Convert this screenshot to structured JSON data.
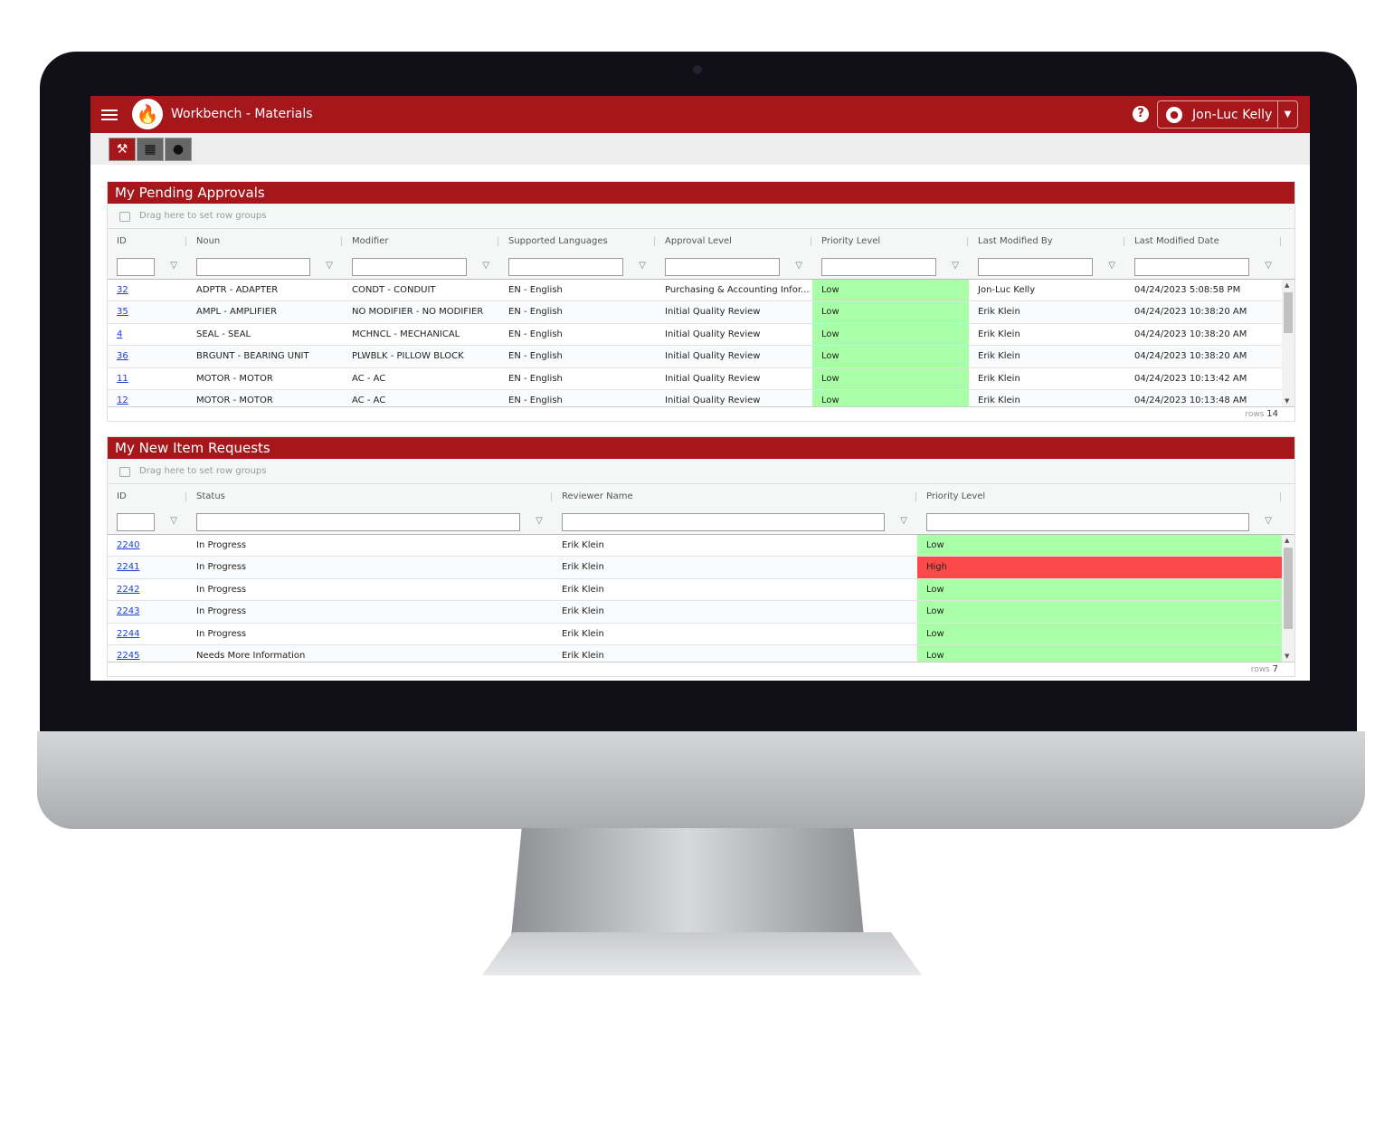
{
  "app": {
    "title": "Workbench - Materials",
    "user": "Jon-Luc Kelly",
    "brand_color": "#a5171a"
  },
  "toolbar": {
    "icons": [
      "hammer-icon",
      "building-icon",
      "wrench-icon"
    ]
  },
  "pending": {
    "title": "My Pending Approvals",
    "group_hint": "Drag here to set row groups",
    "columns": [
      "ID",
      "Noun",
      "Modifier",
      "Supported Languages",
      "Approval Level",
      "Priority Level",
      "Last Modified By",
      "Last Modified Date"
    ],
    "rows": [
      [
        "32",
        "ADPTR - ADAPTER",
        "CONDT - CONDUIT",
        "EN - English",
        "Purchasing & Accounting Infor...",
        "Low",
        "Jon-Luc Kelly",
        "04/24/2023 5:08:58 PM"
      ],
      [
        "35",
        "AMPL - AMPLIFIER",
        "NO MODIFIER - NO MODIFIER",
        "EN - English",
        "Initial Quality Review",
        "Low",
        "Erik Klein",
        "04/24/2023 10:38:20 AM"
      ],
      [
        "4",
        "SEAL - SEAL",
        "MCHNCL - MECHANICAL",
        "EN - English",
        "Initial Quality Review",
        "Low",
        "Erik Klein",
        "04/24/2023 10:38:20 AM"
      ],
      [
        "36",
        "BRGUNT - BEARING UNIT",
        "PLWBLK - PILLOW BLOCK",
        "EN - English",
        "Initial Quality Review",
        "Low",
        "Erik Klein",
        "04/24/2023 10:38:20 AM"
      ],
      [
        "11",
        "MOTOR - MOTOR",
        "AC - AC",
        "EN - English",
        "Initial Quality Review",
        "Low",
        "Erik Klein",
        "04/24/2023 10:13:42 AM"
      ],
      [
        "12",
        "MOTOR - MOTOR",
        "AC - AC",
        "EN - English",
        "Initial Quality Review",
        "Low",
        "Erik Klein",
        "04/24/2023 10:13:48 AM"
      ]
    ],
    "rows_label": "rows",
    "rows_count": "14"
  },
  "requests": {
    "title": "My New Item Requests",
    "group_hint": "Drag here to set row groups",
    "columns": [
      "ID",
      "Status",
      "Reviewer Name",
      "Priority Level"
    ],
    "rows": [
      [
        "2240",
        "In Progress",
        "Erik Klein",
        "Low"
      ],
      [
        "2241",
        "In Progress",
        "Erik Klein",
        "High"
      ],
      [
        "2242",
        "In Progress",
        "Erik Klein",
        "Low"
      ],
      [
        "2243",
        "In Progress",
        "Erik Klein",
        "Low"
      ],
      [
        "2244",
        "In Progress",
        "Erik Klein",
        "Low"
      ],
      [
        "2245",
        "Needs More Information",
        "Erik Klein",
        "Low"
      ]
    ],
    "rows_label": "rows",
    "rows_count": "7"
  },
  "colors": {
    "low": "#a8ffa8",
    "high": "#fc4848"
  }
}
